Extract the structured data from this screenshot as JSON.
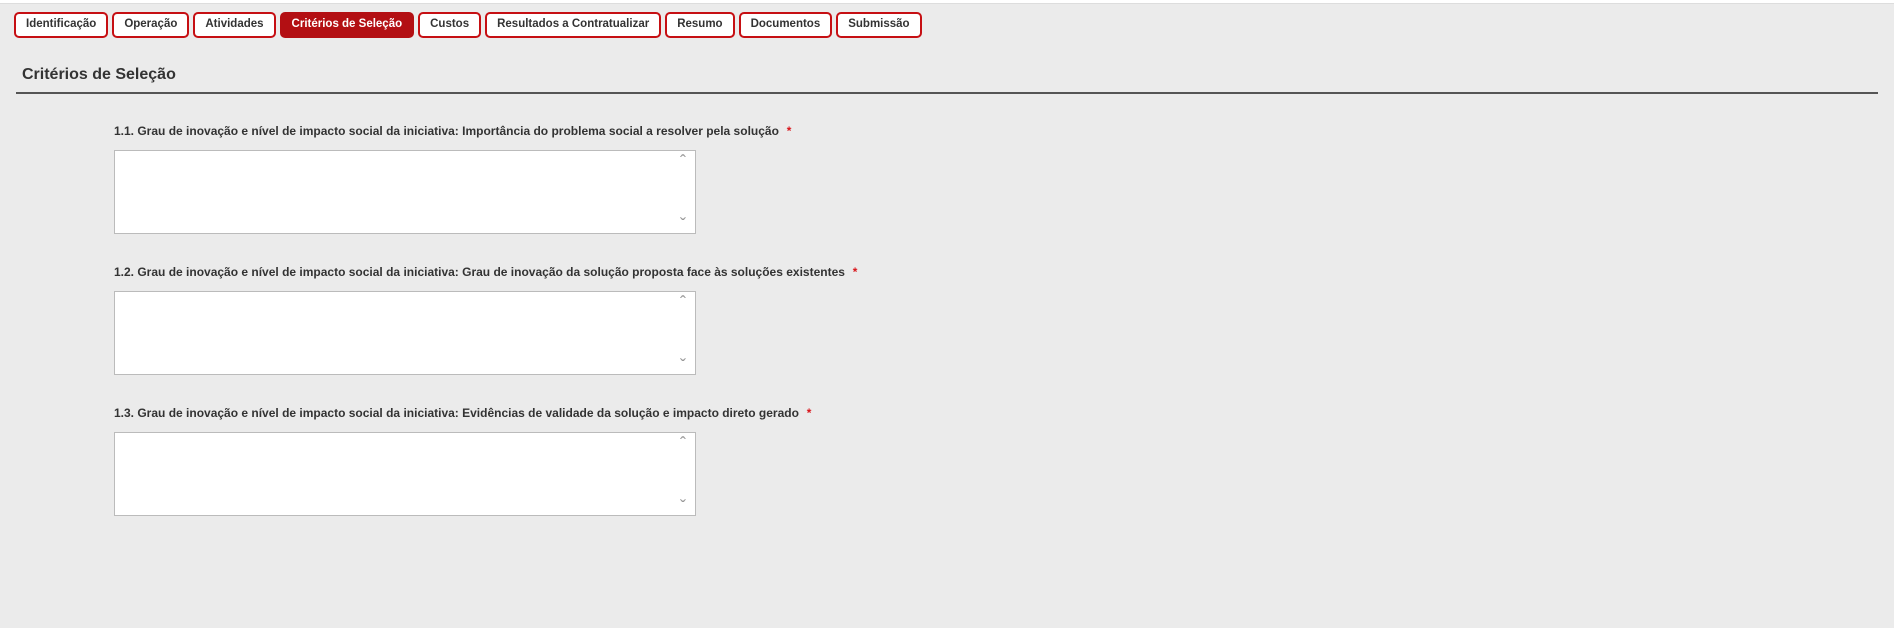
{
  "tabs": {
    "identificacao": "Identificação",
    "operacao": "Operação",
    "atividades": "Atividades",
    "criterios": "Critérios de Seleção",
    "custos": "Custos",
    "resultados": "Resultados a Contratualizar",
    "resumo": "Resumo",
    "documentos": "Documentos",
    "submissao": "Submissão"
  },
  "page": {
    "title": "Critérios de Seleção"
  },
  "fields": {
    "q1": {
      "label": "1.1. Grau de inovação e nível de impacto social da iniciativa: Importância do problema social a resolver pela solução",
      "required": "*",
      "value": ""
    },
    "q2": {
      "label": "1.2. Grau de inovação e nível de impacto social da iniciativa: Grau de inovação da solução proposta face às soluções existentes",
      "required": "*",
      "value": ""
    },
    "q3": {
      "label": "1.3. Grau de inovação e nível de impacto social da iniciativa: Evidências de validade da solução e impacto direto gerado",
      "required": "*",
      "value": ""
    }
  }
}
